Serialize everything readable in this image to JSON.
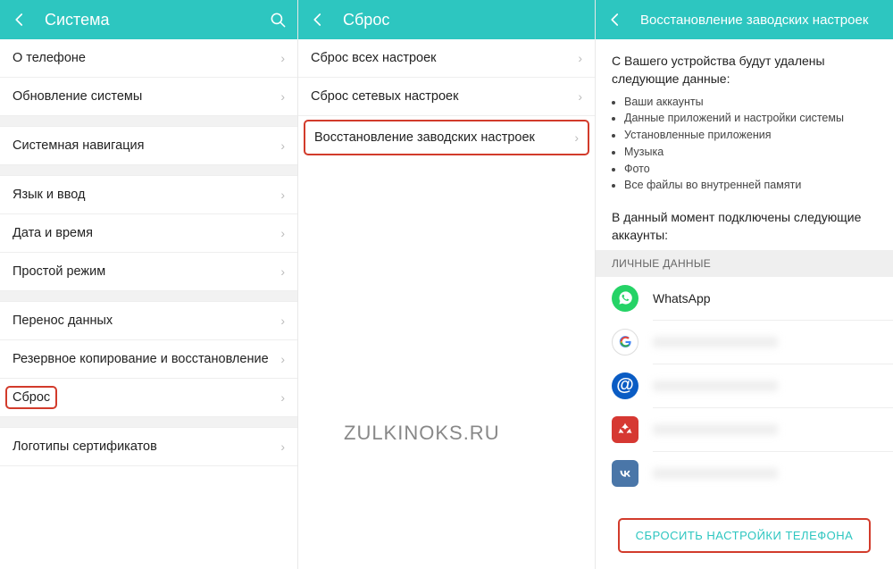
{
  "panel1": {
    "title": "Система",
    "items": [
      {
        "label": "О телефоне"
      },
      {
        "label": "Обновление системы"
      },
      {
        "label": "Системная навигация",
        "gapBefore": true
      },
      {
        "label": "Язык и ввод",
        "gapBefore": true
      },
      {
        "label": "Дата и время"
      },
      {
        "label": "Простой режим"
      },
      {
        "label": "Перенос данных",
        "gapBefore": true
      },
      {
        "label": "Резервное копирование и восстановление"
      },
      {
        "label": "Сброс",
        "highlighted": true
      },
      {
        "label": "Логотипы сертификатов",
        "gapBefore": true
      }
    ]
  },
  "panel2": {
    "title": "Сброс",
    "items": [
      {
        "label": "Сброс всех настроек"
      },
      {
        "label": "Сброс сетевых настроек"
      },
      {
        "label": "Восстановление заводских настроек",
        "highlightedRow": true
      }
    ]
  },
  "panel3": {
    "title": "Восстановление заводских настроек",
    "info1": "С Вашего устройства будут удалены следующие данные:",
    "bullets": [
      "Ваши аккаунты",
      "Данные приложений и настройки системы",
      "Установленные приложения",
      "Музыка",
      "Фото",
      "Все файлы во внутренней памяти"
    ],
    "info2": "В данный момент подключены следующие аккаунты:",
    "sectionHeader": "ЛИЧНЫЕ ДАННЫЕ",
    "accounts": [
      {
        "icon": "whatsapp",
        "label": "WhatsApp",
        "blurred": false
      },
      {
        "icon": "google",
        "label": "",
        "blurred": true
      },
      {
        "icon": "mail",
        "label": "",
        "blurred": true
      },
      {
        "icon": "huawei",
        "label": "",
        "blurred": true
      },
      {
        "icon": "vk",
        "label": "",
        "blurred": true
      }
    ],
    "resetBtn": "СБРОСИТЬ НАСТРОЙКИ ТЕЛЕФОНА"
  },
  "watermark": "ZULKINOKS.RU"
}
